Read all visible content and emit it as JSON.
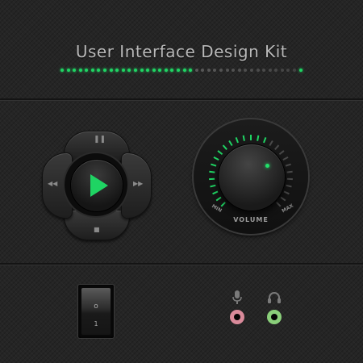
{
  "header": {
    "title": "User Interface Design Kit",
    "indicator_colors": [
      "#1fd463",
      "#5a5a5a"
    ]
  },
  "player": {
    "pause_icon": "pause-icon",
    "stop_icon": "stop-icon",
    "rewind_icon": "rewind-icon",
    "forward_icon": "fast-forward-icon",
    "play_icon": "play-icon",
    "accent": "#1fd463"
  },
  "volume": {
    "label": "VOLUME",
    "min_label": "MIN",
    "max_label": "MAX",
    "level": 0.6,
    "accent": "#1fd463"
  },
  "power_switch": {
    "on_label": "o",
    "off_label": "1"
  },
  "audio": {
    "mic_icon": "microphone-icon",
    "headphones_icon": "headphones-icon",
    "mic_jack_color": "#d98a9a",
    "headphone_jack_color": "#8acf7a"
  }
}
